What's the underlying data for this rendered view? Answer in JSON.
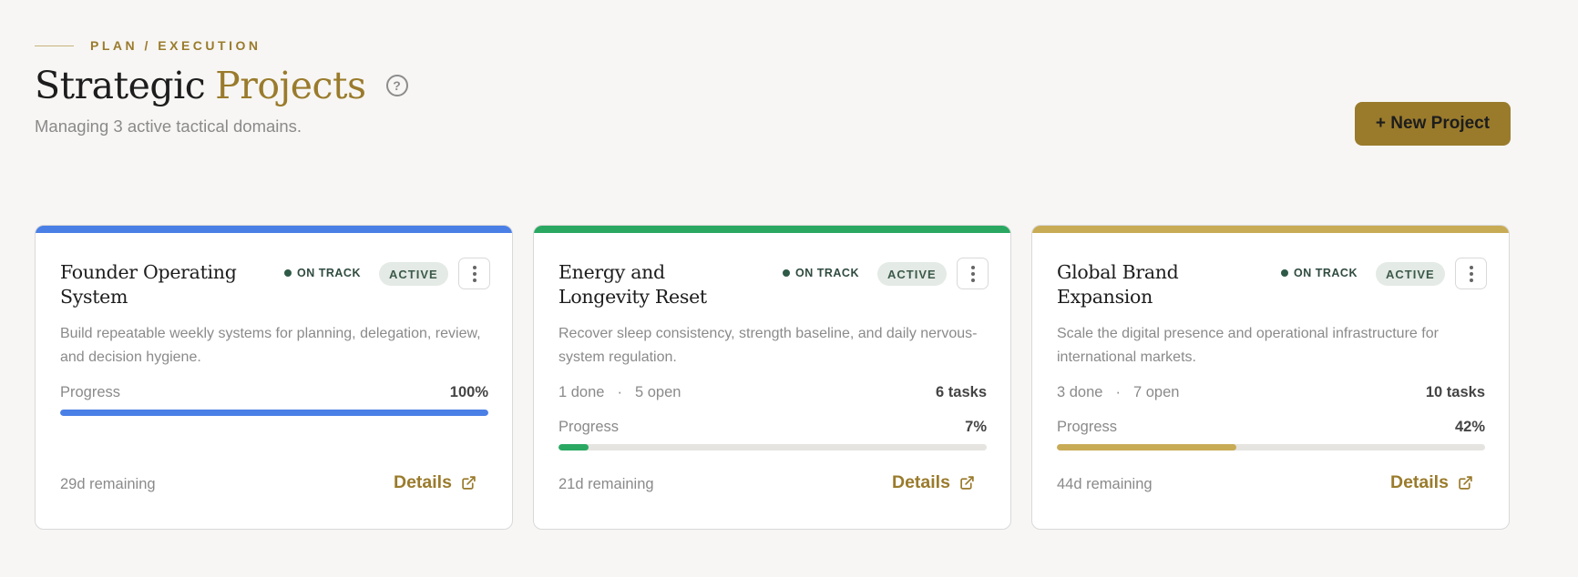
{
  "header": {
    "eyebrow": "PLAN / EXECUTION",
    "title_part1": "Strategic",
    "title_part2": "Projects",
    "help_icon": "question-circle-icon",
    "subtitle": "Managing 3 active tactical domains.",
    "new_button_label": "+ New Project"
  },
  "colors": {
    "accent": "#9a7b2c",
    "card1_bar": "#4a7fe6",
    "card2_bar": "#2aa862",
    "card3_bar": "#c8ab55"
  },
  "cards": [
    {
      "title": "Founder Operating System",
      "status": "ON TRACK",
      "badge": "ACTIVE",
      "description": "Build repeatable weekly systems for planning, delegation, review, and decision hygiene.",
      "progress_label": "Progress",
      "progress_value": 100,
      "progress_text": "100%",
      "remaining": "29d remaining",
      "details_label": "Details"
    },
    {
      "title": "Energy and Longevity Reset",
      "status": "ON TRACK",
      "badge": "ACTIVE",
      "description": "Recover sleep consistency, strength baseline, and daily nervous-system regulation.",
      "done": "1 done",
      "separator": "·",
      "open": "5 open",
      "tasks": "6 tasks",
      "progress_label": "Progress",
      "progress_value": 7,
      "progress_text": "7%",
      "remaining": "21d remaining",
      "details_label": "Details"
    },
    {
      "title": "Global Brand Expansion",
      "status": "ON TRACK",
      "badge": "ACTIVE",
      "description": "Scale the digital presence and operational infrastructure for international markets.",
      "done": "3 done",
      "separator": "·",
      "open": "7 open",
      "tasks": "10 tasks",
      "progress_label": "Progress",
      "progress_value": 42,
      "progress_text": "42%",
      "remaining": "44d remaining",
      "details_label": "Details"
    }
  ]
}
